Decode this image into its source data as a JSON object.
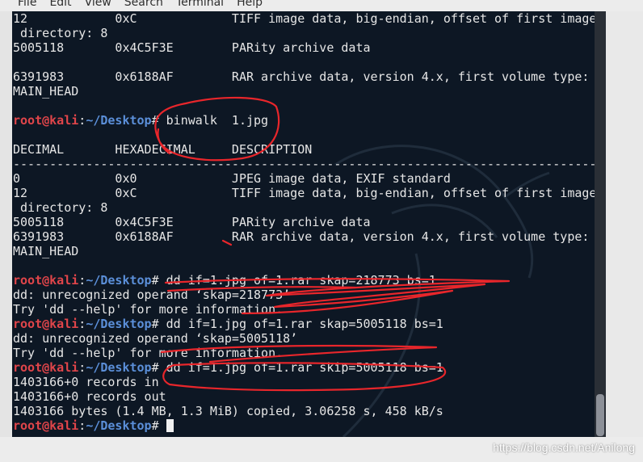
{
  "menu": [
    "File",
    "Edit",
    "View",
    "Search",
    "Terminal",
    "Help"
  ],
  "prompt": {
    "user": "root@kali",
    "sep": ":",
    "path": "~/Desktop",
    "hash": "# "
  },
  "lines": [
    {
      "type": "text",
      "text": "12            0xC             TIFF image data, big-endian, offset of first image"
    },
    {
      "type": "text",
      "text": " directory: 8"
    },
    {
      "type": "text",
      "text": "5005118       0x4C5F3E        PARity archive data"
    },
    {
      "type": "text",
      "text": ""
    },
    {
      "type": "text",
      "text": "6391983       0x6188AF        RAR archive data, version 4.x, first volume type:"
    },
    {
      "type": "text",
      "text": "MAIN_HEAD"
    },
    {
      "type": "text",
      "text": ""
    },
    {
      "type": "prompt",
      "cmd": "binwalk  1.jpg"
    },
    {
      "type": "text",
      "text": ""
    },
    {
      "type": "text",
      "text": "DECIMAL       HEXADECIMAL     DESCRIPTION"
    },
    {
      "type": "text",
      "text": "--------------------------------------------------------------------------------"
    },
    {
      "type": "text",
      "text": "0             0x0             JPEG image data, EXIF standard"
    },
    {
      "type": "text",
      "text": "12            0xC             TIFF image data, big-endian, offset of first image"
    },
    {
      "type": "text",
      "text": " directory: 8"
    },
    {
      "type": "text",
      "text": "5005118       0x4C5F3E        PARity archive data"
    },
    {
      "type": "text",
      "text": "6391983       0x6188AF        RAR archive data, version 4.x, first volume type:"
    },
    {
      "type": "text",
      "text": "MAIN_HEAD"
    },
    {
      "type": "text",
      "text": ""
    },
    {
      "type": "prompt",
      "cmd": "dd if=1.jpg of=1.rar skap=218773 bs=1"
    },
    {
      "type": "text",
      "text": "dd: unrecognized operand ‘skap=218773’"
    },
    {
      "type": "text",
      "text": "Try 'dd --help' for more information."
    },
    {
      "type": "prompt",
      "cmd": "dd if=1.jpg of=1.rar skap=5005118 bs=1"
    },
    {
      "type": "text",
      "text": "dd: unrecognized operand ‘skap=5005118’"
    },
    {
      "type": "text",
      "text": "Try 'dd --help' for more information."
    },
    {
      "type": "prompt",
      "cmd": "dd if=1.jpg of=1.rar skip=5005118 bs=1"
    },
    {
      "type": "text",
      "text": "1403166+0 records in"
    },
    {
      "type": "text",
      "text": "1403166+0 records out"
    },
    {
      "type": "text",
      "text": "1403166 bytes (1.4 MB, 1.3 MiB) copied, 3.06258 s, 458 kB/s"
    },
    {
      "type": "prompt",
      "cmd": "",
      "cursor": true
    }
  ],
  "watermark": "https://blog.csdn.net/Anilong",
  "colors": {
    "terminal_bg": "#0d1724",
    "user": "#e0454a",
    "path": "#5b8fd9",
    "text": "#e6e6e6",
    "annotation": "#e8262b"
  }
}
